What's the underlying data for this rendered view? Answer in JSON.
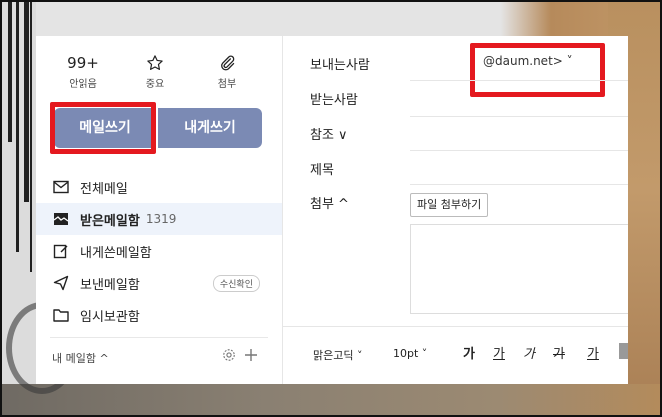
{
  "quick": [
    {
      "value": "99+",
      "label": "안읽음",
      "icon": "unread-count"
    },
    {
      "value": "",
      "label": "중요",
      "icon": "star-icon"
    },
    {
      "value": "",
      "label": "첨부",
      "icon": "paperclip-icon"
    }
  ],
  "buttons": {
    "write": "메일쓰기",
    "self": "내게쓰기"
  },
  "folders": [
    {
      "label": "전체메일",
      "count": "",
      "chip": ""
    },
    {
      "label": "받은메일함",
      "count": "1319",
      "chip": ""
    },
    {
      "label": "내게쓴메일함",
      "count": "",
      "chip": ""
    },
    {
      "label": "보낸메일함",
      "count": "",
      "chip": "수신확인"
    },
    {
      "label": "임시보관함",
      "count": "",
      "chip": ""
    }
  ],
  "my_mailbox": {
    "label": "내 메일함 ^"
  },
  "compose": {
    "from_label": "보내는사람",
    "to_label": "받는사람",
    "cc_label": "참조 ∨",
    "subject_label": "제목",
    "attach_label": "첨부 ^",
    "sender_value": "@daum.net>  ˅",
    "attach_button": "파일 첨부하기"
  },
  "toolbar": {
    "font": "맑은고딕 ˅",
    "size": "10pt ˅",
    "bold": "가",
    "underline": "가",
    "italic": "가",
    "strike": "가",
    "color": "가"
  },
  "colors": {
    "accent": "#7b8ab4",
    "highlight": "#e4191f",
    "active_bg": "#eef3fb"
  }
}
